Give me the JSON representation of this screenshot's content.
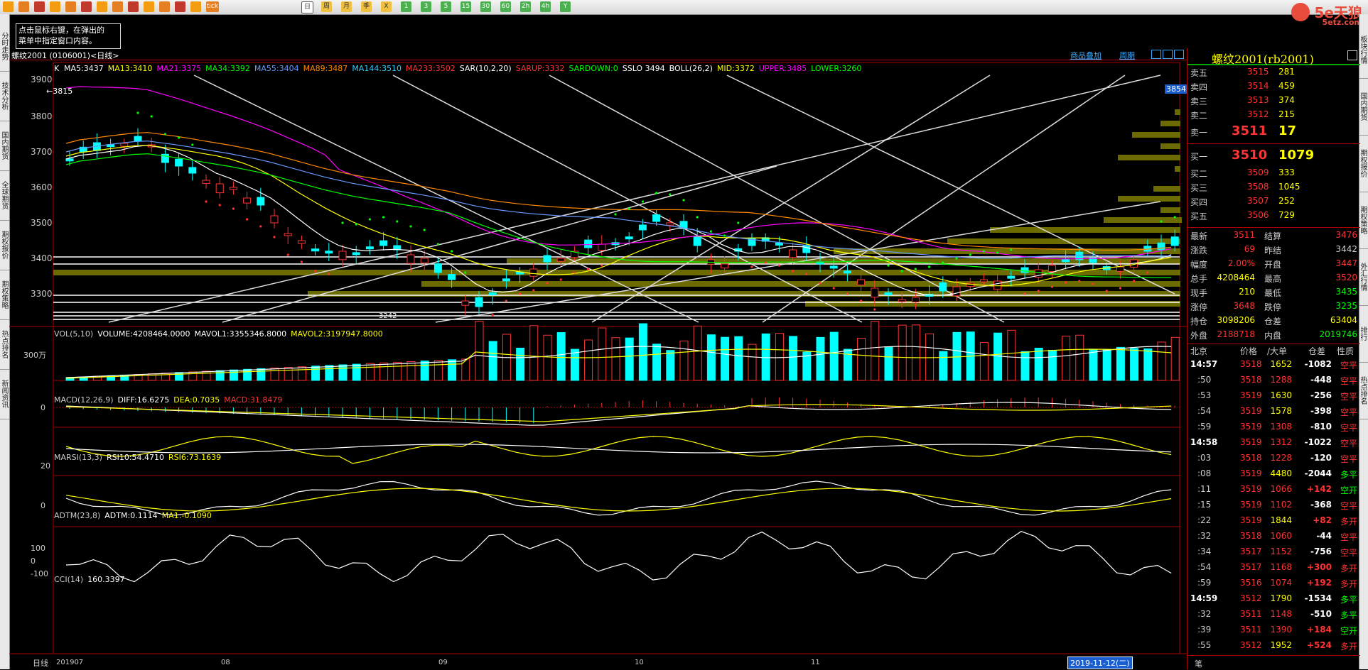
{
  "toolbar": {
    "buttons": [
      "home-icon",
      "book-icon",
      "folder-icon",
      "refresh-icon",
      "zoom-in-icon",
      "zoom-out-icon",
      "window-icon",
      "pen-icon",
      "draw-icon",
      "filter-icon",
      "tool-icon",
      "table-icon",
      "chart-icon",
      "tick-icon"
    ],
    "tick_label": "tick",
    "periods": [
      "日",
      "周",
      "月",
      "季",
      "X",
      "1",
      "3",
      "5",
      "15",
      "30",
      "60",
      "2h",
      "4h",
      "Y"
    ],
    "active_period": "日"
  },
  "logo": {
    "line1": "5e天狼",
    "line2": "5etz.com"
  },
  "tooltip": {
    "line1": "点击鼠标右键，在弹出的",
    "line2": "菜单中指定窗口内容。"
  },
  "left_tabs": [
    "分时走势",
    "技术分析",
    "国内期货",
    "全球期货",
    "期权报价",
    "期权策略",
    "热点排名",
    "新闻资讯"
  ],
  "right_tabs": [
    "板块行情",
    "国内期货",
    "期权报价",
    "期权策略",
    "外汇行情",
    "排行",
    "热点排名"
  ],
  "chart": {
    "header": "螺纹2001 (0106001)<日线>",
    "right_links": [
      "商品叠加",
      "周期"
    ],
    "price_label": "K",
    "indicators_main": [
      {
        "t": "MA5:3437",
        "c": "#ffffff"
      },
      {
        "t": "MA13:3410",
        "c": "#ffff00"
      },
      {
        "t": "MA21:3375",
        "c": "#ff00ff"
      },
      {
        "t": "MA34:3392",
        "c": "#00ff00"
      },
      {
        "t": "MA55:3404",
        "c": "#6699ff"
      },
      {
        "t": "MA89:3487",
        "c": "#ff8800"
      },
      {
        "t": "MA144:3510",
        "c": "#33ccff"
      },
      {
        "t": "MA233:3502",
        "c": "#ff3333"
      },
      {
        "t": "SAR(10,2,20)",
        "c": "#ffffff"
      },
      {
        "t": "SARUP:3332",
        "c": "#ff3333"
      },
      {
        "t": "SARDOWN:0",
        "c": "#00ff00"
      },
      {
        "t": "SSLO 3494",
        "c": "#ffffff"
      },
      {
        "t": "BOLL(26,2)",
        "c": "#ffffff"
      },
      {
        "t": "MID:3372",
        "c": "#ffff00"
      },
      {
        "t": "UPPER:3485",
        "c": "#ff00ff"
      },
      {
        "t": "LOWER:3260",
        "c": "#00ff00"
      }
    ],
    "y_labels": [
      "3900",
      "3800",
      "3700",
      "3600",
      "3500",
      "3400",
      "3300"
    ],
    "max_label": "←3815",
    "min_label": "3242",
    "right_tag": "3854",
    "vol_title": [
      {
        "t": "VOL(5,10)",
        "c": "#cccccc"
      },
      {
        "t": "VOLUME:4208464.0000",
        "c": "#ffffff"
      },
      {
        "t": "MAVOL1:3355346.8000",
        "c": "#ffffff"
      },
      {
        "t": "MAVOL2:3197947.8000",
        "c": "#ffff00"
      }
    ],
    "vol_label": "300万",
    "macd_title": [
      {
        "t": "MACD(12,26,9)",
        "c": "#cccccc"
      },
      {
        "t": "DIFF:16.6275",
        "c": "#ffffff"
      },
      {
        "t": "DEA:0.7035",
        "c": "#ffff00"
      },
      {
        "t": "MACD:31.8479",
        "c": "#ff3333"
      }
    ],
    "macd_label": "0",
    "rsi_title": [
      {
        "t": "MARSI(13,3)",
        "c": "#cccccc"
      },
      {
        "t": "RSI10:54.4710",
        "c": "#ffffff"
      },
      {
        "t": "RSI6:73.1639",
        "c": "#ffff00"
      }
    ],
    "rsi_label": "20",
    "adtm_title": [
      {
        "t": "ADTM(23,8)",
        "c": "#cccccc"
      },
      {
        "t": "ADTM:0.1114",
        "c": "#ffffff"
      },
      {
        "t": "MA1:-0.1090",
        "c": "#ffff00"
      }
    ],
    "adtm_label": "0",
    "cci_title": [
      {
        "t": "CCI(14)",
        "c": "#cccccc"
      },
      {
        "t": "160.3397",
        "c": "#ffffff"
      }
    ],
    "cci_labels": [
      "100",
      "0",
      "-100"
    ],
    "x_axis_prefix": "日线",
    "x_labels": [
      "201907",
      "08",
      "09",
      "10",
      "11"
    ],
    "cursor_date": "2019-11-12(二)"
  },
  "quote": {
    "title": "螺纹2001(rb2001)",
    "asks": [
      [
        "卖五",
        "3515",
        "281"
      ],
      [
        "卖四",
        "3514",
        "459"
      ],
      [
        "卖三",
        "3513",
        "374"
      ],
      [
        "卖二",
        "3512",
        "215"
      ],
      [
        "卖一",
        "3511",
        "17"
      ]
    ],
    "bids": [
      [
        "买一",
        "3510",
        "1079"
      ],
      [
        "买二",
        "3509",
        "333"
      ],
      [
        "买三",
        "3508",
        "1045"
      ],
      [
        "买四",
        "3507",
        "252"
      ],
      [
        "买五",
        "3506",
        "729"
      ]
    ],
    "stats": [
      [
        "最新",
        "3511",
        "结算",
        "3476"
      ],
      [
        "涨跌",
        "69",
        "昨结",
        "3442"
      ],
      [
        "幅度",
        "2.00%",
        "开盘",
        "3447"
      ],
      [
        "总手",
        "4208464",
        "最高",
        "3520"
      ],
      [
        "现手",
        "210",
        "最低",
        "3435"
      ],
      [
        "涨停",
        "3648",
        "跌停",
        "3235"
      ],
      [
        "持仓",
        "3098206",
        "仓差",
        "63404"
      ],
      [
        "外盘",
        "2188718",
        "内盘",
        "2019746"
      ]
    ],
    "ticks_header": [
      "北京",
      "价格",
      "∕大单",
      "仓差",
      "性质"
    ],
    "ticks": [
      [
        "14:57",
        "3518",
        "1652",
        "-1082",
        "空平"
      ],
      [
        ":50",
        "3518",
        "1288",
        "-448",
        "空平"
      ],
      [
        ":53",
        "3519",
        "1630",
        "-256",
        "空平"
      ],
      [
        ":54",
        "3519",
        "1578",
        "-398",
        "空平"
      ],
      [
        ":59",
        "3519",
        "1308",
        "-810",
        "空平"
      ],
      [
        "14:58",
        "3519",
        "1312",
        "-1022",
        "空平"
      ],
      [
        ":03",
        "3518",
        "1228",
        "-120",
        "空平"
      ],
      [
        ":08",
        "3519",
        "4480",
        "-2044",
        "多平"
      ],
      [
        ":11",
        "3519",
        "1066",
        "+142",
        "空开"
      ],
      [
        ":15",
        "3519",
        "1102",
        "-368",
        "空平"
      ],
      [
        ":22",
        "3519",
        "1844",
        "+82",
        "多开"
      ],
      [
        ":32",
        "3518",
        "1060",
        "-44",
        "空平"
      ],
      [
        ":34",
        "3517",
        "1152",
        "-756",
        "空平"
      ],
      [
        ":54",
        "3517",
        "1168",
        "+300",
        "多开"
      ],
      [
        ":59",
        "3516",
        "1074",
        "+192",
        "多开"
      ],
      [
        "14:59",
        "3512",
        "1790",
        "-1534",
        "多平"
      ],
      [
        ":32",
        "3511",
        "1148",
        "-510",
        "多平"
      ],
      [
        ":39",
        "3511",
        "1390",
        "+184",
        "空开"
      ],
      [
        ":55",
        "3512",
        "1952",
        "+524",
        "多开"
      ]
    ],
    "bottom_label": "笔"
  }
}
